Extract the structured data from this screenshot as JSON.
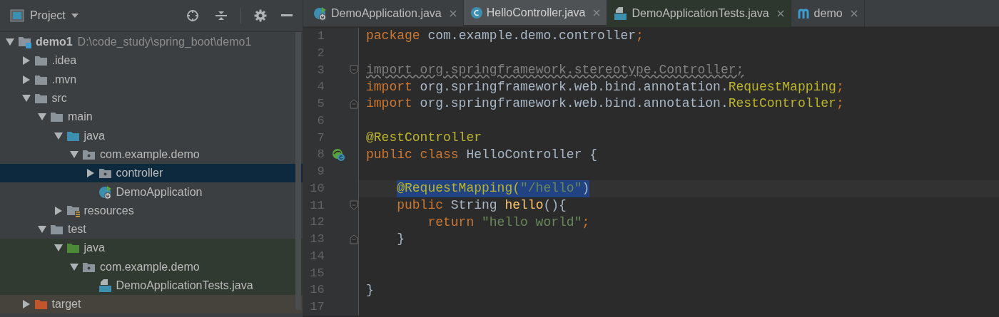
{
  "project_panel": {
    "title": "Project",
    "tree": [
      {
        "kind": "module",
        "label": "demo1",
        "path": "D:\\code_study\\spring_boot\\demo1",
        "expanded": true,
        "selected": false,
        "children": [
          {
            "kind": "folder",
            "label": ".idea",
            "expanded": false,
            "selected": false
          },
          {
            "kind": "folder",
            "label": ".mvn",
            "expanded": false,
            "selected": false
          },
          {
            "kind": "folder",
            "label": "src",
            "expanded": true,
            "selected": false,
            "children": [
              {
                "kind": "folder",
                "label": "main",
                "expanded": true,
                "selected": false,
                "children": [
                  {
                    "kind": "source-folder",
                    "label": "java",
                    "expanded": true,
                    "selected": false,
                    "children": [
                      {
                        "kind": "package",
                        "label": "com.example.demo",
                        "expanded": true,
                        "selected": false,
                        "children": [
                          {
                            "kind": "package",
                            "label": "controller",
                            "expanded": false,
                            "selected": true
                          },
                          {
                            "kind": "spring-class",
                            "label": "DemoApplication",
                            "selected": false
                          }
                        ]
                      }
                    ]
                  },
                  {
                    "kind": "resources",
                    "label": "resources",
                    "expanded": false,
                    "selected": false
                  }
                ]
              },
              {
                "kind": "folder",
                "label": "test",
                "expanded": true,
                "selected": false,
                "children": [
                  {
                    "kind": "test-folder",
                    "label": "java",
                    "expanded": true,
                    "selected": false,
                    "children": [
                      {
                        "kind": "package",
                        "label": "com.example.demo",
                        "expanded": true,
                        "selected": false,
                        "children": [
                          {
                            "kind": "test-class",
                            "label": "DemoApplicationTests.java",
                            "selected": false
                          }
                        ]
                      }
                    ]
                  }
                ]
              }
            ]
          },
          {
            "kind": "excluded",
            "label": "target",
            "expanded": false,
            "selected": false
          }
        ]
      }
    ]
  },
  "editor": {
    "tabs": [
      {
        "kind": "spring-class",
        "label": "DemoApplication.java",
        "selected": false
      },
      {
        "kind": "class",
        "label": "HelloController.java",
        "selected": true
      },
      {
        "kind": "test-class",
        "label": "DemoApplicationTests.java",
        "selected": false
      },
      {
        "kind": "maven",
        "label": "demo",
        "selected": false
      }
    ],
    "lines": [
      {
        "number": "1",
        "tokens": [
          {
            "t": "package",
            "kind": "keyword"
          },
          {
            "t": " com.example.demo.controller",
            "kind": "plain"
          },
          {
            "t": ";",
            "kind": "keyword"
          }
        ]
      },
      {
        "number": "2"
      },
      {
        "number": "3",
        "fold_start": true,
        "tokens": [
          {
            "t": "import org.springframework.stereotype.Controller;",
            "kind": "unused"
          }
        ]
      },
      {
        "number": "4",
        "tokens": [
          {
            "t": "import",
            "kind": "keyword"
          },
          {
            "t": " org.springframework.web.bind.annotation.",
            "kind": "plain"
          },
          {
            "t": "RequestMapping",
            "kind": "annotation"
          },
          {
            "t": ";",
            "kind": "keyword"
          }
        ]
      },
      {
        "number": "5",
        "fold_end": true,
        "tokens": [
          {
            "t": "import",
            "kind": "keyword"
          },
          {
            "t": " org.springframework.web.bind.annotation.",
            "kind": "plain"
          },
          {
            "t": "RestController",
            "kind": "annotation"
          },
          {
            "t": ";",
            "kind": "keyword"
          }
        ]
      },
      {
        "number": "6"
      },
      {
        "number": "7",
        "tokens": [
          {
            "t": "@RestController",
            "kind": "annotation"
          }
        ]
      },
      {
        "number": "8",
        "bean_marker": true,
        "tokens": [
          {
            "t": "public class",
            "kind": "keyword"
          },
          {
            "t": " HelloController {",
            "kind": "plain"
          }
        ],
        "children": [
          {
            "number": "9"
          },
          {
            "number": "10",
            "current": true,
            "tokens": [
              {
                "t": "@RequestMapping(",
                "kind": "annotation",
                "selected": true
              },
              {
                "t": "\"/hello\"",
                "kind": "string",
                "selected": true
              },
              {
                "t": ")",
                "kind": "plain",
                "selected": true
              }
            ]
          },
          {
            "number": "11",
            "fold_start": true,
            "tokens": [
              {
                "t": "public",
                "kind": "keyword"
              },
              {
                "t": " String ",
                "kind": "plain"
              },
              {
                "t": "hello",
                "kind": "method"
              },
              {
                "t": "(){",
                "kind": "plain"
              }
            ],
            "children": [
              {
                "number": "12",
                "tokens": [
                  {
                    "t": "return",
                    "kind": "keyword"
                  },
                  {
                    "t": " \"hello world\"",
                    "kind": "string"
                  },
                  {
                    "t": ";",
                    "kind": "keyword"
                  }
                ]
              }
            ]
          },
          {
            "number": "13",
            "fold_end": true,
            "tokens": [
              {
                "t": "}",
                "kind": "plain"
              }
            ]
          },
          {
            "number": "14"
          },
          {
            "number": "15"
          }
        ]
      },
      {
        "number": "16",
        "tokens": [
          {
            "t": "}",
            "kind": "plain"
          }
        ]
      },
      {
        "number": "17"
      }
    ]
  }
}
